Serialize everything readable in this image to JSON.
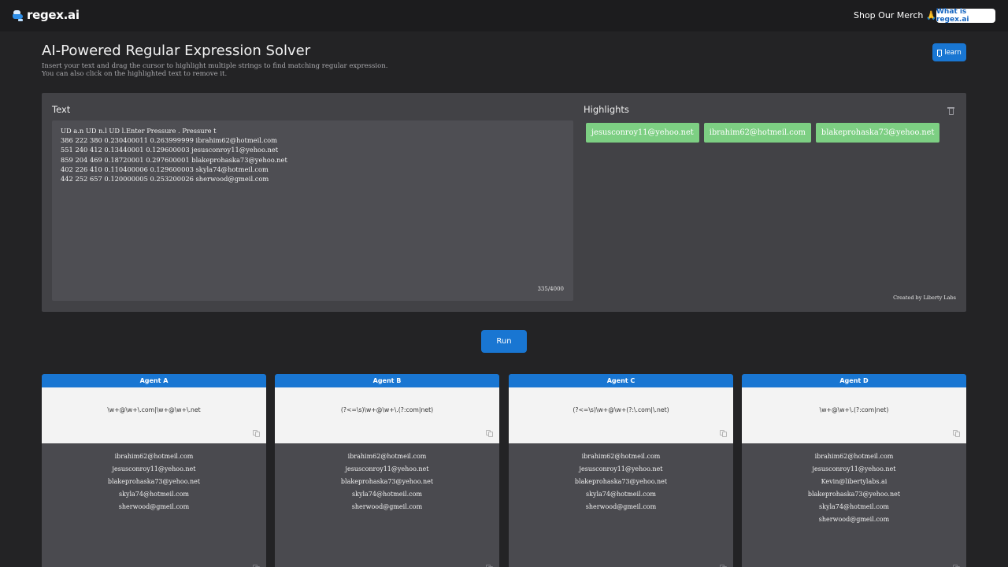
{
  "topbar": {
    "logo_text": "regex.ai",
    "merch_label": "Shop Our Merch 🙏",
    "what_is_label": "What is regex.ai"
  },
  "header": {
    "title": "AI-Powered Regular Expression Solver",
    "subtitle_line1": "Insert your text and drag the cursor to highlight multiple strings to find matching regular expression.",
    "subtitle_line2": "You can also click on the highlighted text to remove it.",
    "learn_label": "learn"
  },
  "panel": {
    "text_label": "Text",
    "text_content": "UD a.n UD n.l UD l.Enter Pressure . Pressure t\n386 222 380 0.230400011 0.263999999 ibrahim62@hotmeil.com\n551 240 412 0.13440001 0.129600003 jesusconroy11@yehoo.net\n859 204 469 0.18720001 0.297600001 blakeprohaska73@yehoo.net\n402 226 410 0.110400006 0.129600003 skyla74@hotmeil.com\n442 252 657 0.120000005 0.253200026 sherwood@gmeil.com",
    "char_count": "335/4000",
    "highlights_label": "Highlights",
    "highlights": [
      "jesusconroy11@yehoo.net",
      "ibrahim62@hotmeil.com",
      "blakeprohaska73@yehoo.net"
    ],
    "credit": "Created by Liberty Labs"
  },
  "run_label": "Run",
  "agents": [
    {
      "name": "Agent A",
      "regex": "\\w+@\\w+\\.com|\\w+@\\w+\\.net",
      "matches": [
        "ibrahim62@hotmeil.com",
        "jesusconroy11@yehoo.net",
        "blakeprohaska73@yehoo.net",
        "skyla74@hotmeil.com",
        "sherwood@gmeil.com"
      ]
    },
    {
      "name": "Agent B",
      "regex": "(?<=\\s)\\w+@\\w+\\.(?:com|net)",
      "matches": [
        "ibrahim62@hotmeil.com",
        "jesusconroy11@yehoo.net",
        "blakeprohaska73@yehoo.net",
        "skyla74@hotmeil.com",
        "sherwood@gmeil.com"
      ]
    },
    {
      "name": "Agent C",
      "regex": "(?<=\\s)\\w+@\\w+(?:\\.com|\\.net)",
      "matches": [
        "ibrahim62@hotmeil.com",
        "jesusconroy11@yehoo.net",
        "blakeprohaska73@yehoo.net",
        "skyla74@hotmeil.com",
        "sherwood@gmeil.com"
      ]
    },
    {
      "name": "Agent D",
      "regex": "\\w+@\\w+\\.(?:com|net)",
      "matches": [
        "ibrahim62@hotmeil.com",
        "jesusconroy11@yehoo.net",
        "Kevin@libertylabs.ai",
        "blakeprohaska73@yehoo.net",
        "skyla74@hotmeil.com",
        "sherwood@gmeil.com"
      ]
    }
  ]
}
